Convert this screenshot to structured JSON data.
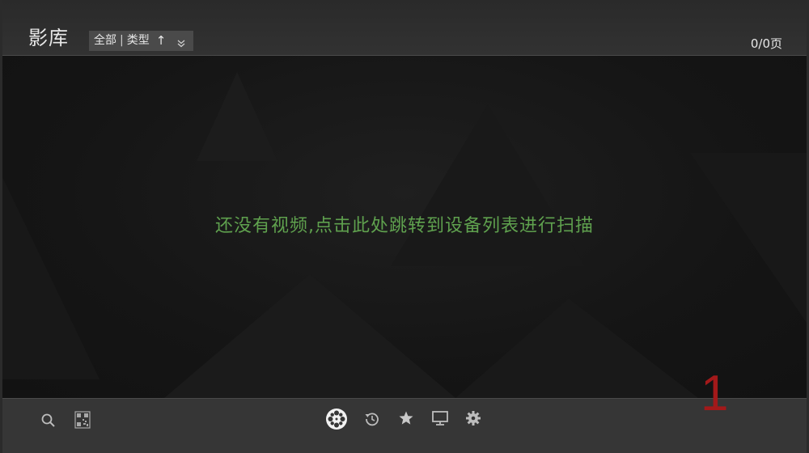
{
  "header": {
    "title": "影库",
    "filter": {
      "scope": "全部",
      "separator": "|",
      "sort_field": "类型",
      "sort_arrow": "↑"
    },
    "page_count": "0/0页"
  },
  "main": {
    "empty_message": "还没有视频,点击此处跳转到设备列表进行扫描"
  },
  "bottom_nav": {
    "icons": [
      "search-icon",
      "qr-code-icon",
      "film-reel-icon",
      "history-icon",
      "star-icon",
      "monitor-icon",
      "gear-icon"
    ],
    "active": "film-reel-icon"
  },
  "overlay": {
    "page_number": "1"
  },
  "colors": {
    "accent_green": "#5fa14e",
    "page_number_red": "#a3191a",
    "text_light": "#e8e8e8",
    "bar_background": "#363636"
  }
}
